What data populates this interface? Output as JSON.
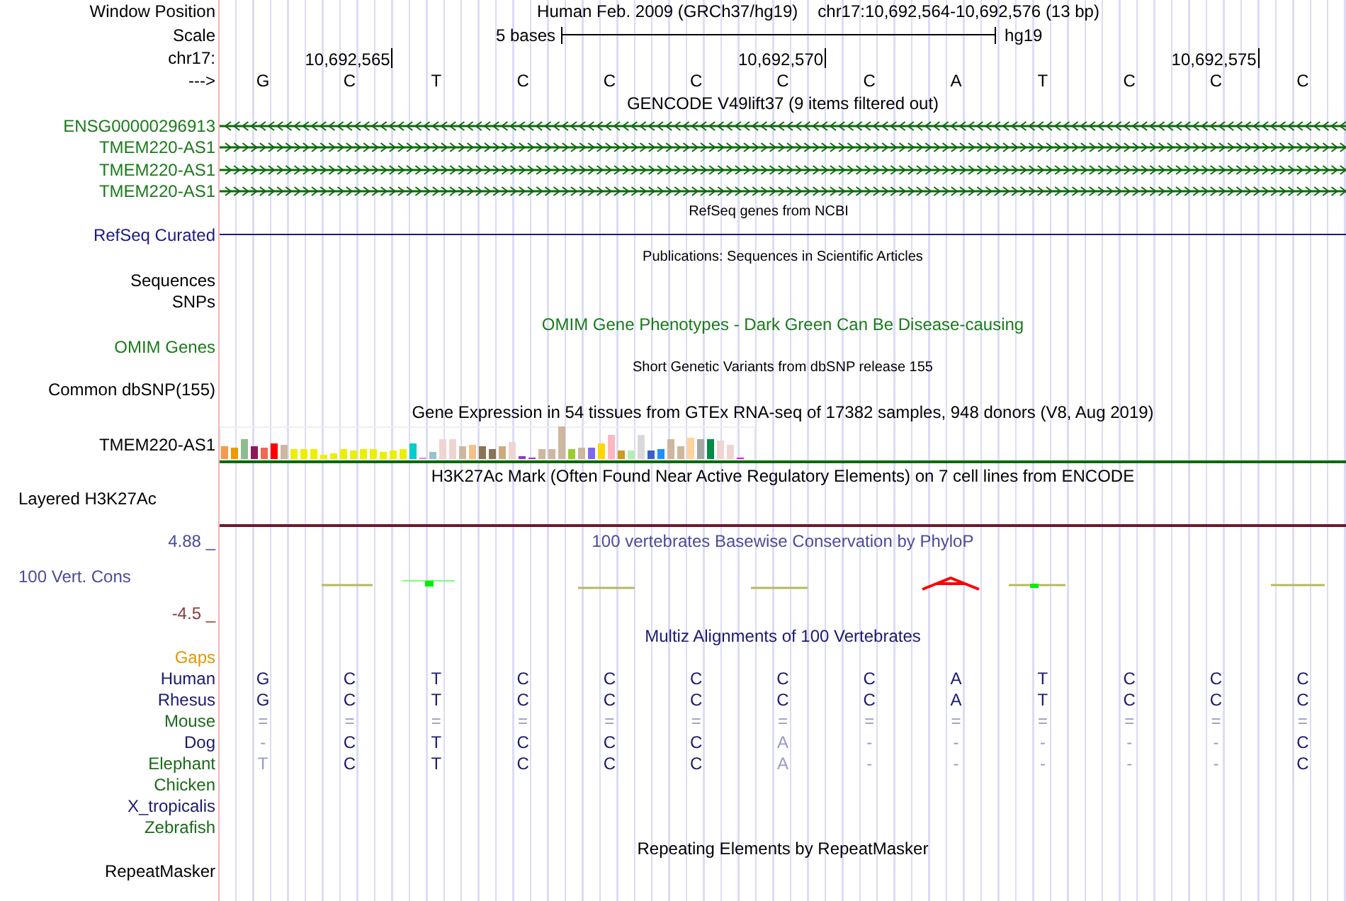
{
  "header": {
    "position_label": "Window Position",
    "title": "Human Feb. 2009 (GRCh37/hg19)",
    "position": "chr17:10,692,564-10,692,576 (13 bp)",
    "scale_label": "Scale",
    "scale_text": "5 bases",
    "assembly": "hg19",
    "chrom_label": "chr17:",
    "ticks": [
      "10,692,565",
      "10,692,570",
      "10,692,575"
    ],
    "strand_label": "--->",
    "bases": [
      "G",
      "C",
      "T",
      "C",
      "C",
      "C",
      "C",
      "C",
      "A",
      "T",
      "C",
      "C",
      "C"
    ]
  },
  "gencode": {
    "title": "GENCODE V49lift37 (9 items filtered out)",
    "items": [
      {
        "label": "ENSG00000296913",
        "reverse": true
      },
      {
        "label": "TMEM220-AS1",
        "reverse": false
      },
      {
        "label": "TMEM220-AS1",
        "reverse": false
      },
      {
        "label": "TMEM220-AS1",
        "reverse": false
      }
    ]
  },
  "refseq": {
    "title": "RefSeq genes from NCBI",
    "label": "RefSeq Curated"
  },
  "publications": {
    "title": "Publications: Sequences in Scientific Articles",
    "labels": [
      "Sequences",
      "SNPs"
    ]
  },
  "omim": {
    "title": "OMIM Gene Phenotypes - Dark Green Can Be Disease-causing",
    "label": "OMIM Genes"
  },
  "dbsnp": {
    "title": "Short Genetic Variants from dbSNP release 155",
    "label": "Common dbSNP(155)"
  },
  "gtex": {
    "title": "Gene Expression in 54 tissues from GTEx RNA-seq of 17382 samples, 948 donors (V8, Aug 2019)",
    "label": "TMEM220-AS1"
  },
  "h3k27ac": {
    "title": "H3K27Ac Mark (Often Found Near Active Regulatory Elements) on 7 cell lines from ENCODE",
    "label": "Layered H3K27Ac"
  },
  "phylop": {
    "title": "100 vertebrates Basewise Conservation by PhyloP",
    "label": "100 Vert. Cons",
    "max": "4.88 _",
    "min": "-4.5 _"
  },
  "multiz": {
    "title": "Multiz Alignments of 100 Vertebrates",
    "gaps_label": "Gaps",
    "rows": [
      {
        "species": "Human",
        "color": "#1a1a70",
        "bases": [
          {
            "base": "G",
            "dim": false
          },
          {
            "base": "C",
            "dim": false
          },
          {
            "base": "T",
            "dim": false
          },
          {
            "base": "C",
            "dim": false
          },
          {
            "base": "C",
            "dim": false
          },
          {
            "base": "C",
            "dim": false
          },
          {
            "base": "C",
            "dim": false
          },
          {
            "base": "C",
            "dim": false
          },
          {
            "base": "A",
            "dim": false
          },
          {
            "base": "T",
            "dim": false
          },
          {
            "base": "C",
            "dim": false
          },
          {
            "base": "C",
            "dim": false
          },
          {
            "base": "C",
            "dim": false
          }
        ]
      },
      {
        "species": "Rhesus",
        "color": "#1a1a70",
        "bases": [
          {
            "base": "G",
            "dim": false
          },
          {
            "base": "C",
            "dim": false
          },
          {
            "base": "T",
            "dim": false
          },
          {
            "base": "C",
            "dim": false
          },
          {
            "base": "C",
            "dim": false
          },
          {
            "base": "C",
            "dim": false
          },
          {
            "base": "C",
            "dim": false
          },
          {
            "base": "C",
            "dim": false
          },
          {
            "base": "A",
            "dim": false
          },
          {
            "base": "T",
            "dim": false
          },
          {
            "base": "C",
            "dim": false
          },
          {
            "base": "C",
            "dim": false
          },
          {
            "base": "C",
            "dim": false
          }
        ]
      },
      {
        "species": "Mouse",
        "color": "#1a6b1a",
        "bases": [
          {
            "base": "=",
            "dim": true
          },
          {
            "base": "=",
            "dim": true
          },
          {
            "base": "=",
            "dim": true
          },
          {
            "base": "=",
            "dim": true
          },
          {
            "base": "=",
            "dim": true
          },
          {
            "base": "=",
            "dim": true
          },
          {
            "base": "=",
            "dim": true
          },
          {
            "base": "=",
            "dim": true
          },
          {
            "base": "=",
            "dim": true
          },
          {
            "base": "=",
            "dim": true
          },
          {
            "base": "=",
            "dim": true
          },
          {
            "base": "=",
            "dim": true
          },
          {
            "base": "=",
            "dim": true
          }
        ]
      },
      {
        "species": "Dog",
        "color": "#1a1a70",
        "bases": [
          {
            "base": "-",
            "dim": true
          },
          {
            "base": "C",
            "dim": false
          },
          {
            "base": "T",
            "dim": false
          },
          {
            "base": "C",
            "dim": false
          },
          {
            "base": "C",
            "dim": false
          },
          {
            "base": "C",
            "dim": false
          },
          {
            "base": "A",
            "dim": true
          },
          {
            "base": "-",
            "dim": true
          },
          {
            "base": "-",
            "dim": true
          },
          {
            "base": "-",
            "dim": true
          },
          {
            "base": "-",
            "dim": true
          },
          {
            "base": "-",
            "dim": true
          },
          {
            "base": "C",
            "dim": false
          }
        ]
      },
      {
        "species": "Elephant",
        "color": "#1a6b1a",
        "bases": [
          {
            "base": "T",
            "dim": true
          },
          {
            "base": "C",
            "dim": false
          },
          {
            "base": "T",
            "dim": false
          },
          {
            "base": "C",
            "dim": false
          },
          {
            "base": "C",
            "dim": false
          },
          {
            "base": "C",
            "dim": false
          },
          {
            "base": "A",
            "dim": true
          },
          {
            "base": "-",
            "dim": true
          },
          {
            "base": "-",
            "dim": true
          },
          {
            "base": "-",
            "dim": true
          },
          {
            "base": "-",
            "dim": true
          },
          {
            "base": "-",
            "dim": true
          },
          {
            "base": "C",
            "dim": false
          }
        ]
      },
      {
        "species": "Chicken",
        "color": "#1a6b1a"
      },
      {
        "species": "X_tropicalis",
        "color": "#1a1a70"
      },
      {
        "species": "Zebrafish",
        "color": "#1a6b1a"
      }
    ]
  },
  "repeatmasker": {
    "title": "Repeating Elements by RepeatMasker",
    "label": "RepeatMasker"
  }
}
